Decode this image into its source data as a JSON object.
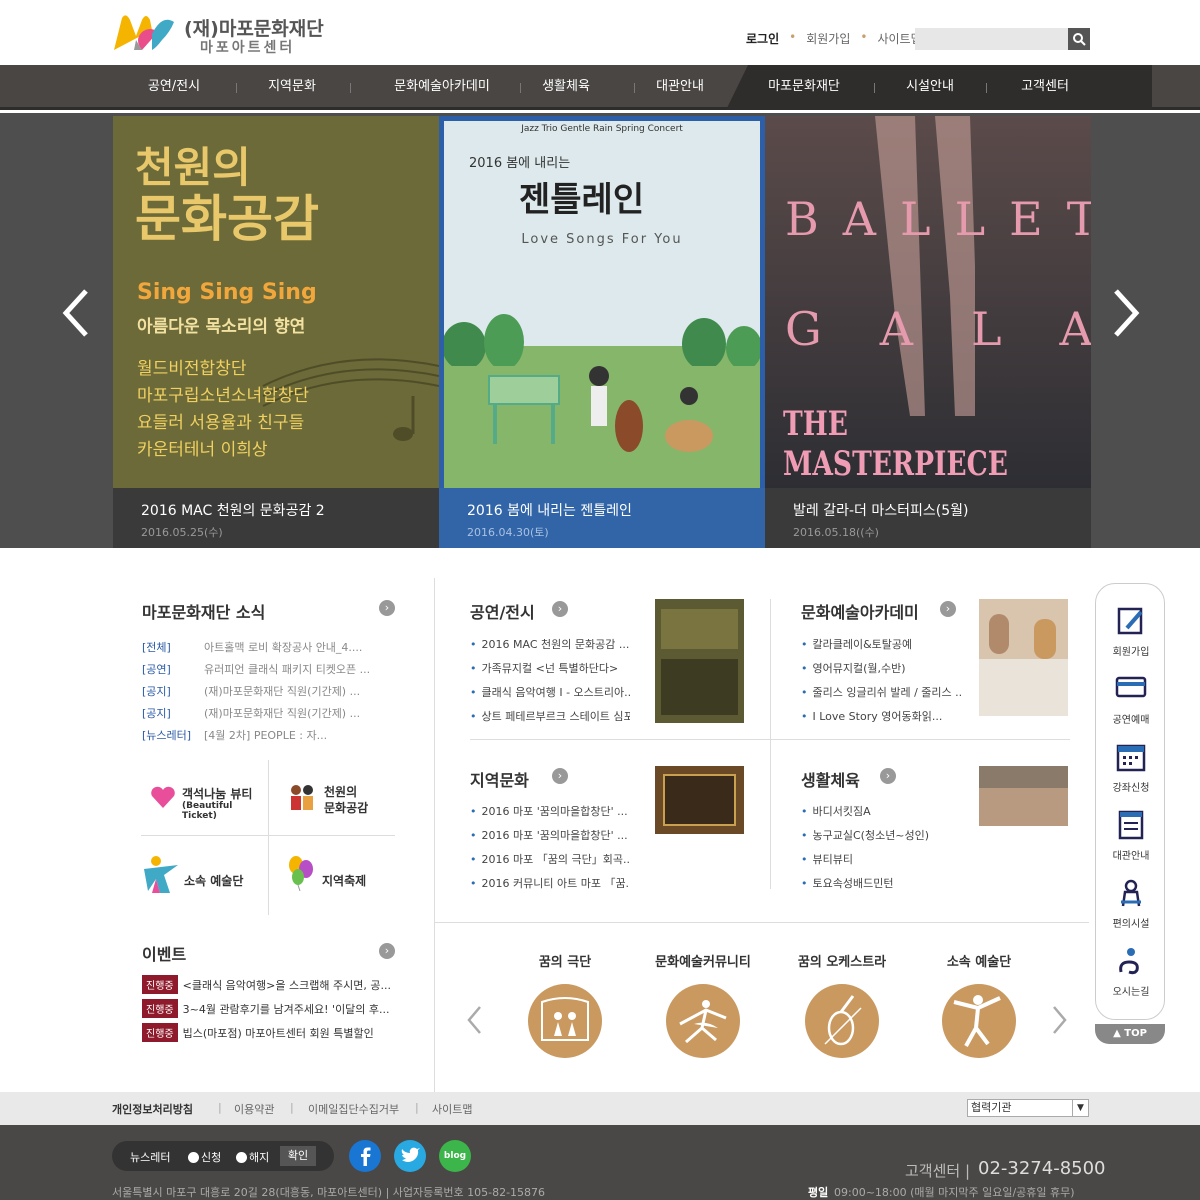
{
  "header": {
    "org_name": "(재)마포문화재단",
    "sub_name": "마포아트센터",
    "util": [
      "로그인",
      "회원가입",
      "사이트맵"
    ],
    "search_placeholder": ""
  },
  "gnb": [
    "공연/전시",
    "지역문화",
    "문화예술아카데미",
    "생활체육",
    "대관안내",
    "마포문화재단",
    "시설안내",
    "고객센터"
  ],
  "visual": {
    "slides": [
      {
        "title": "2016 MAC 천원의 문화공감 2",
        "date": "2016.05.25(수)",
        "poster": {
          "head1": "천원의",
          "head2": "문화공감",
          "sing": "Sing Sing Sing",
          "sub": "아름다운 목소리의 향연",
          "lines": [
            "월드비전합창단",
            "마포구립소년소녀합창단",
            "요들러 서용율과 친구들",
            "카운터테너 이희상"
          ]
        }
      },
      {
        "title": "2016 봄에 내리는 젠틀레인",
        "date": "2016.04.30(토)",
        "poster": {
          "top": "Jazz Trio Gentle Rain Spring Concert",
          "head1": "2016 봄에 내리는",
          "head2": "젠틀레인",
          "sub": "Love Songs For You"
        }
      },
      {
        "title": "발레 갈라-더 마스터피스(5월)",
        "date": "2016.05.18((수)",
        "poster": {
          "w1": "BALLET",
          "w2": "GALA",
          "w3": "THE MASTERPIECE"
        }
      }
    ]
  },
  "news": {
    "title": "마포문화재단 소식",
    "items": [
      {
        "cat": "[전체]",
        "text": "아트홀맥 로비 확장공사 안내_4...."
      },
      {
        "cat": "[공연]",
        "text": "유러피언 클래식 패키지 티켓오픈 ..."
      },
      {
        "cat": "[공지]",
        "text": "(재)마포문화재단 직원(기간제) ..."
      },
      {
        "cat": "[공지]",
        "text": "(재)마포문화재단 직원(기간제) ..."
      },
      {
        "cat": "[뉴스레터]",
        "text": "[4월 2차] PEOPLE : 자..."
      }
    ]
  },
  "banners": [
    {
      "label": "객석나눔 뷰티",
      "sub": "(Beautiful Ticket)"
    },
    {
      "label": "천원의",
      "sub": "문화공감"
    },
    {
      "label": "소속 예술단",
      "sub": ""
    },
    {
      "label": "지역축제",
      "sub": ""
    }
  ],
  "event": {
    "title": "이벤트",
    "badge": "진행중",
    "items": [
      "<클래식 음악여행>을 스크랩해 주시면, 공...",
      "3~4월 관람후기를 남겨주세요! '이달의 후...",
      "빕스(마포점) 마포아트센터 회원 특별할인"
    ]
  },
  "boards": [
    {
      "title": "공연/전시",
      "items": [
        "2016 MAC 천원의 문화공감 ...",
        "가족뮤지컬 <넌 특별하단다>",
        "클래식 음악여행 Ⅰ - 오스트리아...",
        "상트 페테르부르크 스테이트 심포니"
      ]
    },
    {
      "title": "문화예술아카데미",
      "items": [
        "칼라클레이&토탈공예",
        "영어뮤지컬(월,수반)",
        "줄리스 잉글리쉬 발레 / 줄리스 ...",
        "I Love Story 영어동화읽..."
      ]
    },
    {
      "title": "지역문화",
      "items": [
        "2016 마포 '꿈의마을합창단' ...",
        "2016 마포 '꿈의마을합창단' ...",
        "2016 마포 「꿈의 극단」회곡...",
        "2016 커뮤니티 아트 마포 「꿈..."
      ]
    },
    {
      "title": "생활체육",
      "items": [
        "바디서킷짐A",
        "농구교실C(청소년~성인)",
        "뷰티뷰티",
        "토요속성배드민턴"
      ]
    }
  ],
  "groups": [
    "꿈의 극단",
    "문화예술커뮤니티",
    "꿈의 오케스트라",
    "소속 예술단"
  ],
  "quick": [
    "회원가입",
    "공연예매",
    "강좌신청",
    "대관안내",
    "편의시설",
    "오시는길"
  ],
  "top_label": "TOP",
  "footer": {
    "links": [
      "개인정보처리방침",
      "이용약관",
      "이메일집단수집거부",
      "사이트맵"
    ],
    "select": "협력기관",
    "newsletter": "뉴스레터",
    "opt1": "신청",
    "opt2": "해지",
    "confirm": "확인",
    "blog": "blog",
    "cs_label": "고객센터",
    "cs_phone": "02-3274-8500",
    "address": "서울특별시 마포구 대흥로 20길 28(대흥동, 마포아트센터) | 사업자등록번호 105-82-15876",
    "hours_label": "평일",
    "hours": "09:00~18:00 (매월 마지막주 일요일/공휴일 휴무)"
  },
  "colors": {
    "gnb": "#4a4644",
    "gnb_dark": "#2f2d2c",
    "accent_blue": "#2a6db5",
    "brown": "#c99960",
    "badge": "#8e1a2b"
  }
}
